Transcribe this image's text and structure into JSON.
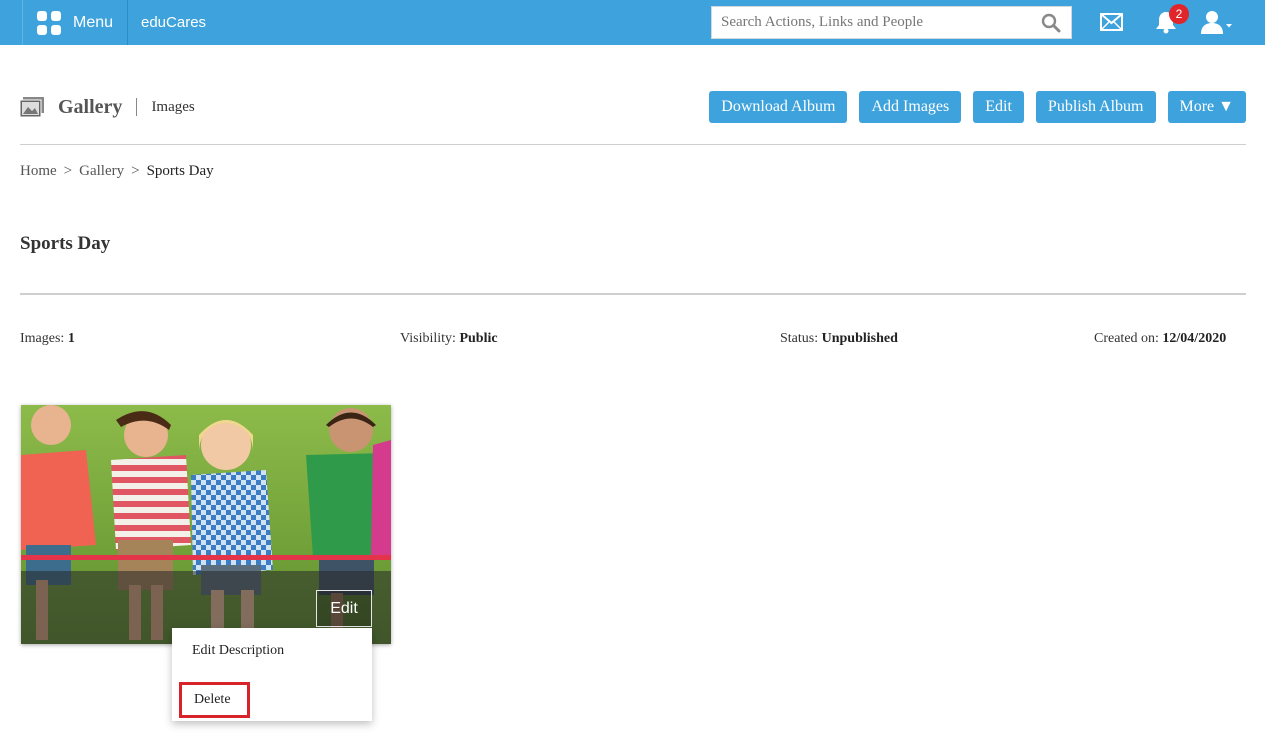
{
  "topbar": {
    "menu_label": "Menu",
    "brand": "eduCares",
    "search_placeholder": "Search Actions, Links and People",
    "notification_count": "2",
    "icons": [
      "grid-icon",
      "search-icon",
      "mail-icon",
      "bell-icon",
      "user-icon",
      "chevron-down-icon"
    ],
    "background_color": "#3ea3dc",
    "badge_color": "#e0262b"
  },
  "header": {
    "title": "Gallery",
    "subtitle": "Images",
    "actions": [
      "Download Album",
      "Add Images",
      "Edit",
      "Publish Album",
      "More ▼"
    ]
  },
  "breadcrumb": {
    "items": [
      "Home",
      "Gallery",
      "Sports Day"
    ],
    "separator": ">"
  },
  "album": {
    "title": "Sports Day",
    "meta": {
      "images_label": "Images:",
      "images_value": "1",
      "visibility_label": "Visibility:",
      "visibility_value": "Public",
      "status_label": "Status:",
      "status_value": "Unpublished",
      "created_label": "Created on:",
      "created_value": "12/04/2020"
    }
  },
  "image_card": {
    "edit_label": "Edit",
    "menu": {
      "edit_description": "Edit Description",
      "delete": "Delete"
    },
    "highlight_color": "#d8232a"
  }
}
